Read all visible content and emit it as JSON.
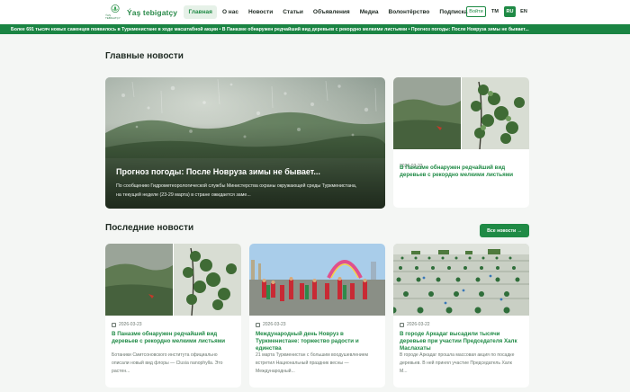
{
  "header": {
    "logo_small": "ÝAŞ TEBIGATÇY",
    "logo_text": "Ýaş tebigatçy",
    "nav": [
      "Главная",
      "О нас",
      "Новости",
      "Статьи",
      "Объявления",
      "Медиа",
      "Волонтёрство",
      "Подписка"
    ],
    "login": "Войти",
    "langs": [
      "TM",
      "RU",
      "EN"
    ]
  },
  "ticker": "Более 691 тысяч новых саженцев появилось в Туркменистане в ходе масштабной акции • В Паназме обнаружен редчайший вид деревьев с рекордно мелкими листьями • Прогноз погоды: После Новруза зимы не бывает...",
  "main_news": {
    "title": "Главные новости",
    "hero": {
      "title": "Прогноз погоды: После Новруза зимы не бывает...",
      "excerpt": "По сообщению Гидрометеорологической службы Министерства охраны окружающей среды Туркменистана, на текущей неделе (23-29 марта) в стране ожидается заме..."
    },
    "side": {
      "date": "2026-03-23",
      "title": "В Паназме обнаружен редчайший вид деревьев с рекордно мелкими листьями"
    }
  },
  "latest": {
    "title": "Последние новости",
    "all_button": "Все новости →",
    "cards": [
      {
        "date": "2026-03-23",
        "title": "В Паназме обнаружен редчайший вид деревьев с рекордно мелкими листьями",
        "excerpt": "Ботаники Смитсоновского института официально описали новый вид флоры — Clusia nanophylla. Это растен..."
      },
      {
        "date": "2026-03-23",
        "title": "Международный день Новруз в Туркменистане: торжество радости и единства",
        "excerpt": "21 марта Туркменистан с большим воодушевлением встретил Национальный праздник весны — Международный..."
      },
      {
        "date": "2026-03-22",
        "title": "В городе Аркадаг высадили тысячи деревьев при участии Председателя Халк Маслахаты",
        "excerpt": "В городе Аркадаг прошла массовая акция по посадке деревьев. В ней принял участие Председатель Халк М..."
      }
    ]
  },
  "colors": {
    "brand": "#1f8a45",
    "ticker": "#1a8443",
    "bg": "#f4f6f4"
  }
}
